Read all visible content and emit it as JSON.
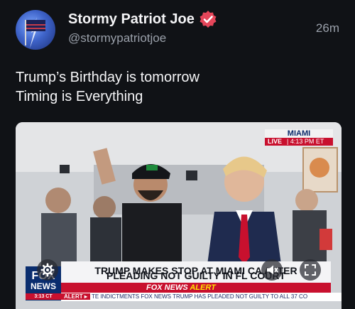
{
  "author": {
    "display_name": "Stormy Patriot Joe",
    "handle": "@stormypatriotjoe",
    "timestamp": "26m",
    "verified_color": "#e5465a"
  },
  "post": {
    "lines": [
      "Trump’s Birthday is tomorrow",
      "Timing is Everything"
    ]
  },
  "media": {
    "location": "MIAMI",
    "live_label": "LIVE",
    "live_time": "| 4:13 PM ET",
    "headline_line1": "TRUMP MAKES STOP AT MIAMI CA   AFTER",
    "headline_line2": "PLEADING NOT GUILTY IN FL COURT",
    "subline_brand": "FOX NEWS",
    "subline_alert": "ALERT",
    "ticker_alert": "ALERT ▸",
    "ticker_text": "TE INDICTMENTS   FOX NEWS   TRUMP HAS PLEADED NOT GUILTY TO ALL 37 CO",
    "logo_fox": "FOX",
    "logo_news": "NEWS",
    "logo_time": "3:13 CT",
    "colors": {
      "fox_red": "#c8102e",
      "fox_navy": "#0a2d6e",
      "alert_yellow": "#ffe400"
    }
  },
  "controls": {
    "settings_icon": "gear-icon",
    "mute_icon": "speaker-mute-icon",
    "fullscreen_icon": "fullscreen-icon"
  }
}
